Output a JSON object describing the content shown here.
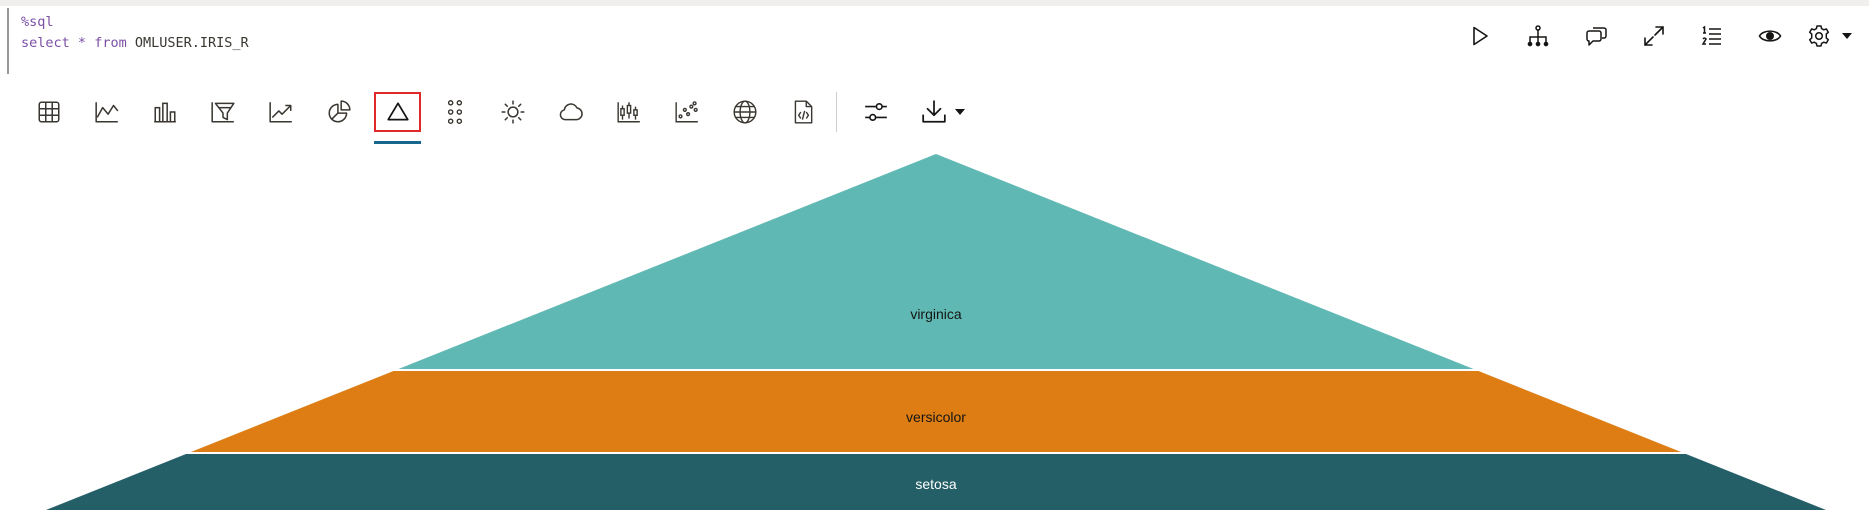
{
  "paragraph": {
    "code_line1": "%sql",
    "code_line2_keyword1": "select",
    "code_line2_star": "*",
    "code_line2_keyword2": "from",
    "code_line2_table": "OMLUSER.IRIS_R"
  },
  "paragraph_actions": [
    {
      "name": "run-paragraph-button",
      "icon": "play-icon"
    },
    {
      "name": "dependencies-button",
      "icon": "hierarchy-icon"
    },
    {
      "name": "comments-button",
      "icon": "chat-bubbles-icon"
    },
    {
      "name": "expand-button",
      "icon": "expand-arrows-icon"
    },
    {
      "name": "line-numbers-button",
      "icon": "numbered-list-icon"
    },
    {
      "name": "visibility-button",
      "icon": "eye-icon"
    },
    {
      "name": "settings-button",
      "icon": "gear-icon"
    }
  ],
  "visualization_toolbar": {
    "items": [
      "table-icon",
      "line-chart-icon",
      "bar-chart-icon",
      "funnel-icon",
      "trend-line-icon",
      "pie-chart-icon",
      "pyramid-icon",
      "dot-grid-icon",
      "sunburst-icon",
      "word-cloud-icon",
      "box-plot-icon",
      "scatter-icon",
      "globe-icon",
      "code-file-icon",
      "settings-sliders-icon",
      "download-icon"
    ],
    "active": "pyramid-icon"
  },
  "colors": {
    "virginica": "#5fb8b3",
    "versicolor": "#dd7d14",
    "setosa": "#245e67",
    "active_outline": "#e0292b",
    "active_underline": "#17668d"
  },
  "chart_data": {
    "type": "pyramid",
    "categories": [
      "virginica",
      "versicolor",
      "setosa"
    ],
    "labels": {
      "virginica": "virginica",
      "versicolor": "versicolor",
      "setosa": "setosa"
    }
  }
}
